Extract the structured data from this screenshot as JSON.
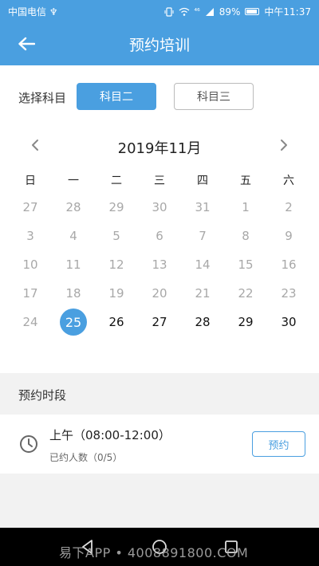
{
  "status_bar": {
    "carrier": "中国电信 ♆",
    "network": "⁴⁶",
    "battery": "89%",
    "time": "中午11:37"
  },
  "header": {
    "title": "预约培训",
    "back_icon": "arrow-left-icon"
  },
  "subject": {
    "label": "选择科目",
    "options": [
      {
        "label": "科目二",
        "active": true
      },
      {
        "label": "科目三",
        "active": false
      }
    ]
  },
  "calendar": {
    "title": "2019年11月",
    "weekdays": [
      "日",
      "一",
      "二",
      "三",
      "四",
      "五",
      "六"
    ],
    "days": [
      {
        "d": "27",
        "state": "disabled"
      },
      {
        "d": "28",
        "state": "disabled"
      },
      {
        "d": "29",
        "state": "disabled"
      },
      {
        "d": "30",
        "state": "disabled"
      },
      {
        "d": "31",
        "state": "disabled"
      },
      {
        "d": "1",
        "state": "disabled"
      },
      {
        "d": "2",
        "state": "disabled"
      },
      {
        "d": "3",
        "state": "disabled"
      },
      {
        "d": "4",
        "state": "disabled"
      },
      {
        "d": "5",
        "state": "disabled"
      },
      {
        "d": "6",
        "state": "disabled"
      },
      {
        "d": "7",
        "state": "disabled"
      },
      {
        "d": "8",
        "state": "disabled"
      },
      {
        "d": "9",
        "state": "disabled"
      },
      {
        "d": "10",
        "state": "disabled"
      },
      {
        "d": "11",
        "state": "disabled"
      },
      {
        "d": "12",
        "state": "disabled"
      },
      {
        "d": "13",
        "state": "disabled"
      },
      {
        "d": "14",
        "state": "disabled"
      },
      {
        "d": "15",
        "state": "disabled"
      },
      {
        "d": "16",
        "state": "disabled"
      },
      {
        "d": "17",
        "state": "disabled"
      },
      {
        "d": "18",
        "state": "disabled"
      },
      {
        "d": "19",
        "state": "disabled"
      },
      {
        "d": "20",
        "state": "disabled"
      },
      {
        "d": "21",
        "state": "disabled"
      },
      {
        "d": "22",
        "state": "disabled"
      },
      {
        "d": "23",
        "state": "disabled"
      },
      {
        "d": "24",
        "state": "disabled"
      },
      {
        "d": "25",
        "state": "selected"
      },
      {
        "d": "26",
        "state": "enabled"
      },
      {
        "d": "27",
        "state": "enabled"
      },
      {
        "d": "28",
        "state": "enabled"
      },
      {
        "d": "29",
        "state": "enabled"
      },
      {
        "d": "30",
        "state": "enabled"
      }
    ]
  },
  "slots": {
    "section_title": "预约时段",
    "items": [
      {
        "name": "上午（08:00-12:00）",
        "count": "已约人数（0/5）",
        "button": "预约"
      }
    ]
  },
  "watermark": "易下APP • 4008891800.COM",
  "colors": {
    "accent": "#4a9fe0",
    "disabled_text": "#a8a8a8",
    "section_bg": "#f2f2f2"
  }
}
